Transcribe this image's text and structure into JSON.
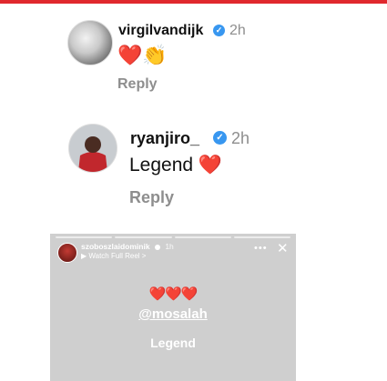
{
  "comments": [
    {
      "username": "virgilvandijk",
      "time": "2h",
      "text": "❤️👏",
      "reply_label": "Reply"
    },
    {
      "username": "ryanjiro_",
      "time": "2h",
      "text": "Legend ❤️",
      "reply_label": "Reply"
    }
  ],
  "story": {
    "username": "szoboszlaidominik",
    "time": "1h",
    "subtitle": "▶ Watch Full Reel >",
    "hearts": "❤️❤️❤️",
    "mention": "@mosalah",
    "caption": "Legend",
    "menu_icon": "more-icon",
    "close_icon": "close-icon"
  },
  "colors": {
    "accent_bar": "#e0282e",
    "verified": "#3897f0",
    "muted_text": "#8e8e8e"
  }
}
